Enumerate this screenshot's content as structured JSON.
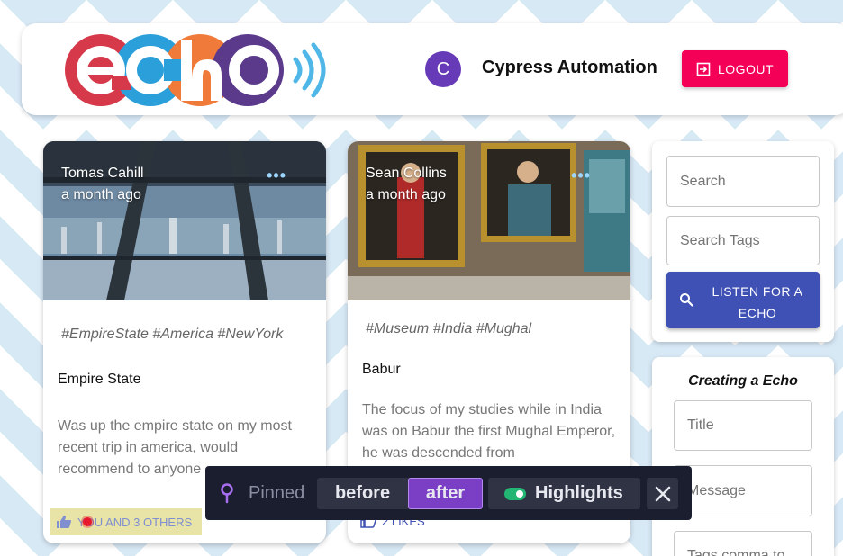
{
  "header": {
    "logo_text": "echo",
    "avatar_initial": "C",
    "user_name": "Cypress Automation",
    "logout_label": "LOGOUT"
  },
  "cards": [
    {
      "author": "Tomas Cahill",
      "time": "a month ago",
      "menu": "•••",
      "tags": "#EmpireState #America #NewYork",
      "title": "Empire State",
      "message": "Was up the empire state on my most recent trip in america, would recommend to anyone",
      "likes": "YOU AND 3 OTHERS"
    },
    {
      "author": "Sean Collins",
      "time": "a month ago",
      "menu": "•••",
      "tags": "#Museum #India #Mughal",
      "title": "Babur",
      "message": "The focus of my studies while in India was on Babur the first Mughal Emperor, he was descended from",
      "likes": "2 LIKES"
    }
  ],
  "search": {
    "search_placeholder": "Search",
    "tags_placeholder": "Search Tags",
    "listen_label": "LISTEN FOR A ECHO"
  },
  "create": {
    "heading": "Creating a Echo",
    "title_placeholder": "Title",
    "message_placeholder": "Message",
    "tags_placeholder": "Tags comma to"
  },
  "toolbar": {
    "pinned_label": "Pinned",
    "before_label": "before",
    "after_label": "after",
    "highlights_label": "Highlights"
  },
  "colors": {
    "primary": "#3f51b5",
    "secondary": "#f50057",
    "avatar": "#673ab7",
    "toolbar_bg": "#1b1e2e",
    "after_active": "#7b3fc6",
    "toggle_on": "#22b573"
  }
}
